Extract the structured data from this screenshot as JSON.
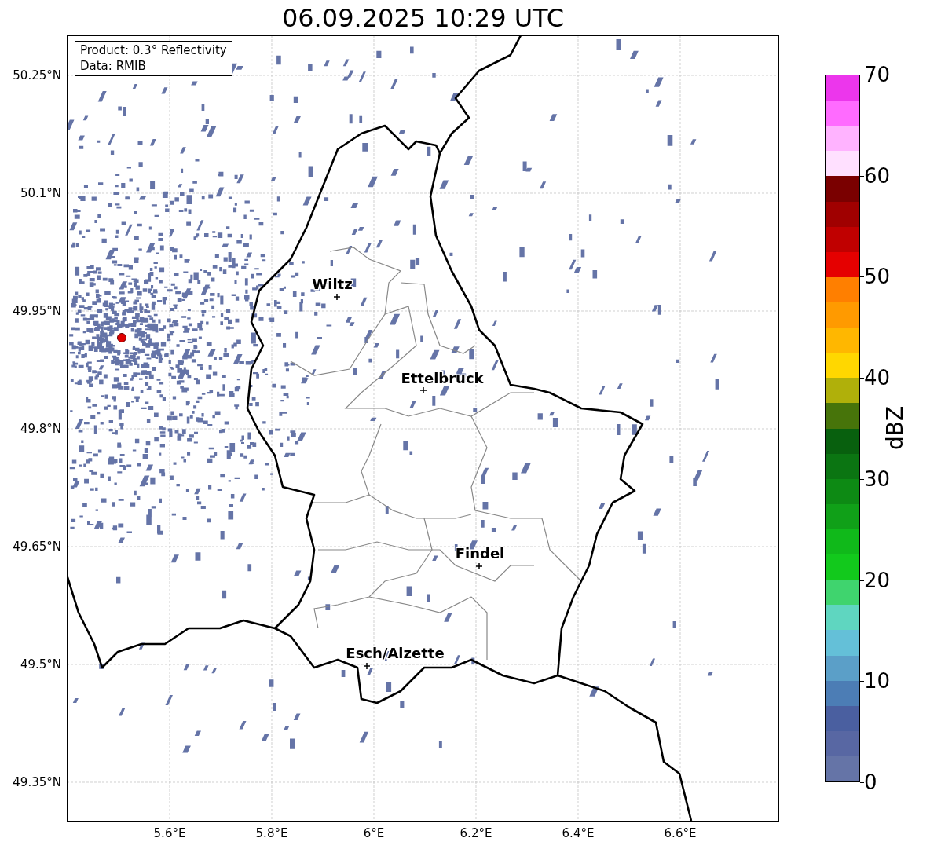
{
  "title": "06.09.2025 10:29 UTC",
  "legend": [
    "Product: 0.3° Reflectivity",
    "Data: RMIB"
  ],
  "y_ticks": [
    "50.25°N",
    "50.1°N",
    "49.95°N",
    "49.8°N",
    "49.65°N",
    "49.5°N",
    "49.35°N"
  ],
  "x_ticks": [
    "5.6°E",
    "5.8°E",
    "6°E",
    "6.2°E",
    "6.4°E",
    "6.6°E"
  ],
  "cities": [
    {
      "name": "Wiltz"
    },
    {
      "name": "Ettelbruck"
    },
    {
      "name": "Findel"
    },
    {
      "name": "Esch/Alzette"
    }
  ],
  "colorbar": {
    "label": "dBZ",
    "ticks": [
      "70",
      "60",
      "50",
      "40",
      "30",
      "20",
      "10",
      "0"
    ],
    "segments": [
      {
        "color": "#ec36ec"
      },
      {
        "color": "#ff6bff"
      },
      {
        "color": "#ffb3ff"
      },
      {
        "color": "#ffe0ff"
      },
      {
        "color": "#7a0000"
      },
      {
        "color": "#a00000"
      },
      {
        "color": "#c00000"
      },
      {
        "color": "#e50000"
      },
      {
        "color": "#ff7f00"
      },
      {
        "color": "#ff9a00"
      },
      {
        "color": "#ffb700"
      },
      {
        "color": "#ffd700"
      },
      {
        "color": "#b0b00a"
      },
      {
        "color": "#47740a"
      },
      {
        "color": "#08600e"
      },
      {
        "color": "#0b7512"
      },
      {
        "color": "#0d8a14"
      },
      {
        "color": "#10a018"
      },
      {
        "color": "#10b91a"
      },
      {
        "color": "#12c91c"
      },
      {
        "color": "#3fd46e"
      },
      {
        "color": "#5fd6c0"
      },
      {
        "color": "#64c0d8"
      },
      {
        "color": "#5b9fc8"
      },
      {
        "color": "#4c7db5"
      },
      {
        "color": "#4a5fa0"
      },
      {
        "color": "#5867a3"
      },
      {
        "color": "#6574a7"
      }
    ]
  }
}
